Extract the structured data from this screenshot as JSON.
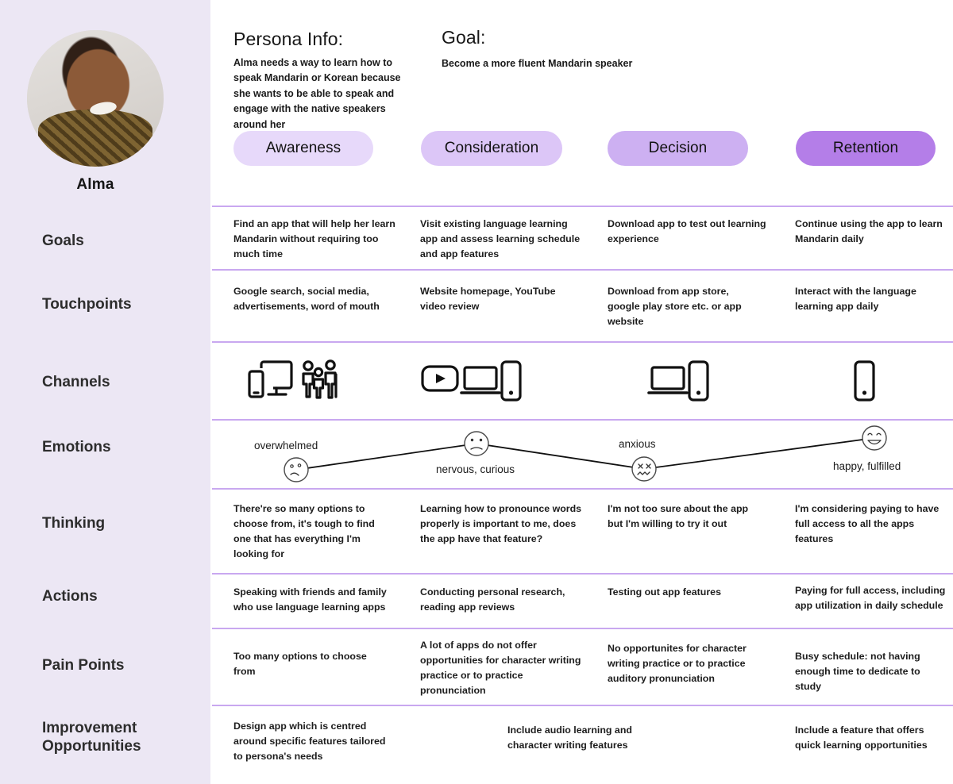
{
  "persona": {
    "name": "Alma",
    "avatar_icon": "persona-photo-avatar"
  },
  "sidebar": {
    "rows": [
      {
        "label": "Goals"
      },
      {
        "label": "Touchpoints"
      },
      {
        "label": "Channels"
      },
      {
        "label": "Emotions"
      },
      {
        "label": "Thinking"
      },
      {
        "label": "Actions"
      },
      {
        "label": "Pain Points"
      },
      {
        "label": "Improvement Opportunities"
      }
    ]
  },
  "header": {
    "persona_info_title": "Persona Info:",
    "persona_info_body": "Alma needs a way to learn how to speak Mandarin or Korean because she wants to be able to speak and engage with the native speakers around her",
    "goal_title": "Goal:",
    "goal_body": "Become a more fluent Mandarin speaker"
  },
  "stages": [
    {
      "label": "Awareness",
      "color": "#e7d9fa"
    },
    {
      "label": "Consideration",
      "color": "#dcc6f7"
    },
    {
      "label": "Decision",
      "color": "#cdb0f2"
    },
    {
      "label": "Retention",
      "color": "#b47ee8"
    }
  ],
  "rows": {
    "goals": [
      "Find an app that will help her learn Mandarin without requiring too much time",
      "Visit existing language learning app and assess learning schedule and app features",
      "Download app to test out learning experience",
      "Continue using the app to learn Mandarin daily"
    ],
    "touchpoints": [
      "Google search, social media, advertisements, word of mouth",
      "Website homepage, YouTube video review",
      "Download from app store, google play store etc. or app website",
      "Interact with the language learning app daily"
    ],
    "channels": [
      [
        "mobile-and-desktop-icon",
        "people-group-icon"
      ],
      [
        "youtube-play-icon",
        "laptop-icon",
        "mobile-phone-icon"
      ],
      [
        "laptop-icon",
        "mobile-phone-icon"
      ],
      [
        "mobile-phone-icon"
      ]
    ],
    "emotions": [
      {
        "label": "overwhelmed",
        "face": "sad-confused-face-icon",
        "level": 1
      },
      {
        "label": "nervous, curious",
        "face": "neutral-frown-face-icon",
        "level": 3
      },
      {
        "label": "anxious",
        "face": "anxious-face-icon",
        "level": 1
      },
      {
        "label": "happy, fulfilled",
        "face": "smiling-face-icon",
        "level": 4
      }
    ],
    "thinking": [
      "There're so many options to choose from, it's tough to find one that has everything I'm looking for",
      "Learning how to pronounce words properly is important to me, does the app have that feature?",
      "I'm not too sure about the app but I'm willing to try it out",
      "I'm considering paying to have full access to all the apps features"
    ],
    "actions": [
      "Speaking with friends and family who use language learning apps",
      "Conducting personal research, reading app reviews",
      "Testing out app features",
      "Paying for full access, including app utilization in daily schedule"
    ],
    "pain_points": [
      "Too many options to choose from",
      "A lot of apps do not offer opportunities for character writing practice or to practice pronunciation",
      "No opportunites for character writing practice or to practice auditory pronunciation",
      "Busy schedule: not having enough time to dedicate to study"
    ],
    "improvement_opportunities": [
      "Design app which is centred around specific features tailored to persona's needs",
      "Include audio learning and character writing features",
      "Include a feature that offers quick learning opportunities"
    ]
  },
  "colors": {
    "sidebar_bg": "#ece7f4",
    "divider": "#c9a8f0",
    "accent": "#b47ee8",
    "text": "#1d1d1d"
  }
}
